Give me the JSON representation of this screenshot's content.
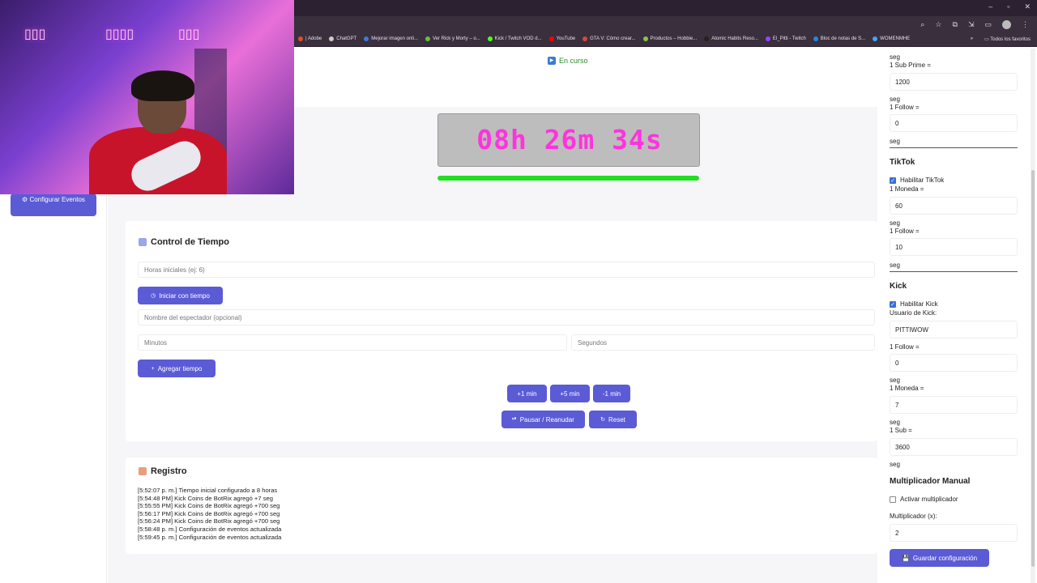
{
  "bookmarks": [
    {
      "label": "| Adobe",
      "color": "#e34c2a"
    },
    {
      "label": "ChatGPT",
      "color": "#cccccc"
    },
    {
      "label": "Mejorar imagen onli...",
      "color": "#3a7bd5"
    },
    {
      "label": "Ver Rick y Morty – o...",
      "color": "#6abf3b"
    },
    {
      "label": "Kick / Twitch VOD d...",
      "color": "#53fc18"
    },
    {
      "label": "YouTube",
      "color": "#ff0000"
    },
    {
      "label": "GTA V: Cómo crear...",
      "color": "#d9463b"
    },
    {
      "label": "Productos – Hobbie...",
      "color": "#8bc34a"
    },
    {
      "label": "Atomic Habits Reso...",
      "color": "#222222"
    },
    {
      "label": "El_Pitti - Twitch",
      "color": "#9146ff"
    },
    {
      "label": "Bloc de notas de S...",
      "color": "#1e88e5"
    },
    {
      "label": "WOMENMHE",
      "color": "#42a5f5"
    }
  ],
  "bookmarks_right": {
    "more": "»",
    "all": "Todos los favoritos"
  },
  "sidebar": {
    "configure_events": "Configurar Eventos"
  },
  "status": {
    "label": "En curso"
  },
  "timer": {
    "display": "08h 26m 34s",
    "progress": 1.0,
    "color": "#ff33dd"
  },
  "time_control": {
    "title": "Control de Tiempo",
    "initial_hours_placeholder": "Horas iniciales (ej: 6)",
    "start_button": "Iniciar con tiempo",
    "viewer_placeholder": "Nombre del espectador (opcional)",
    "minutes_placeholder": "Minutos",
    "seconds_placeholder": "Segundos",
    "add_button": "Agregar tiempo",
    "plus1": "+1 min",
    "plus5": "+5 min",
    "minus1": "-1 min",
    "pause_button": "Pausar / Reanudar",
    "reset_button": "Reset"
  },
  "log": {
    "title": "Registro",
    "lines": [
      "[5:52:07 p. m.] Tiempo inicial configurado a 8 horas",
      "[5:54:48 PM] Kick Coins de BotRix agregó +7 seg",
      "[5:55:55 PM] Kick Coins de BotRix agregó +700 seg",
      "[5:56:17 PM] Kick Coins de BotRix agregó +700 seg",
      "[5:56:24 PM] Kick Coins de BotRix agregó +700 seg",
      "[5:58:48 p. m.] Configuración de eventos actualizada",
      "[5:59:45 p. m.] Configuración de eventos actualizada"
    ]
  },
  "config": {
    "seg": "seg",
    "twitch": {
      "sub_prime_label": "1 Sub Prime =",
      "sub_prime_value": "1200",
      "follow_label": "1 Follow =",
      "follow_value": "0"
    },
    "tiktok": {
      "title": "TikTok",
      "enable_label": "Habilitar TikTok",
      "enabled": true,
      "coin_label": "1 Moneda =",
      "coin_value": "60",
      "follow_label": "1 Follow =",
      "follow_value": "10"
    },
    "kick": {
      "title": "Kick",
      "enable_label": "Habilitar Kick",
      "enabled": true,
      "user_label": "Usuario de Kick:",
      "user_value": "PITTIWOW",
      "follow_label": "1 Follow =",
      "follow_value": "0",
      "coin_label": "1 Moneda =",
      "coin_value": "7",
      "sub_label": "1 Sub =",
      "sub_value": "3600"
    },
    "multiplier": {
      "title": "Multiplicador Manual",
      "activate_label": "Activar multiplicador",
      "activated": false,
      "value_label": "Multiplicador (x):",
      "value": "2"
    },
    "save_button": "Guardar configuración"
  }
}
